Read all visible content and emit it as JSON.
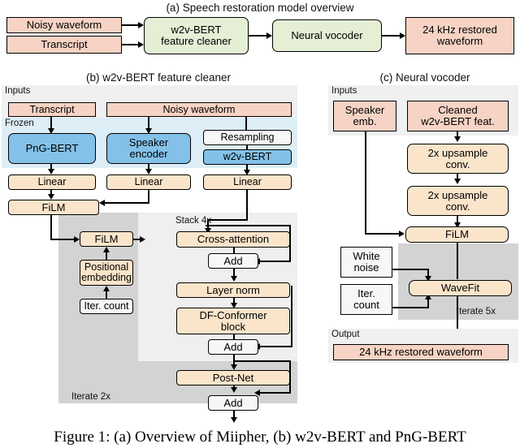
{
  "figure": {
    "caption": "Figure 1: (a) Overview of Miipher, (b) w2v-BERT and PnG-BERT"
  },
  "panel_a": {
    "title": "(a) Speech restoration model overview",
    "nodes": {
      "noisy_waveform": "Noisy waveform",
      "transcript": "Transcript",
      "feature_cleaner_l1": "w2v-BERT",
      "feature_cleaner_l2": "feature cleaner",
      "neural_vocoder": "Neural vocoder",
      "restored_l1": "24 kHz restored",
      "restored_l2": "waveform"
    }
  },
  "panel_b": {
    "title": "(b) w2v-BERT feature cleaner",
    "regions": {
      "inputs": "Inputs",
      "frozen": "Frozen",
      "iterate": "Iterate 2x",
      "stack": "Stack 4x"
    },
    "nodes": {
      "transcript": "Transcript",
      "noisy_waveform": "Noisy waveform",
      "png_bert": "PnG-BERT",
      "speaker_encoder_l1": "Speaker",
      "speaker_encoder_l2": "encoder",
      "resampling": "Resampling",
      "w2v_bert": "w2v-BERT",
      "linear1": "Linear",
      "linear2": "Linear",
      "linear3": "Linear",
      "film_top": "FiLM",
      "film_loop": "FiLM",
      "positional_l1": "Positional",
      "positional_l2": "embedding",
      "iter_count": "Iter. count",
      "cross_attention": "Cross-attention",
      "add1": "Add",
      "layer_norm": "Layer norm",
      "df_conformer_l1": "DF-Conformer",
      "df_conformer_l2": "block",
      "add2": "Add",
      "post_net": "Post-Net",
      "add3": "Add"
    }
  },
  "panel_c": {
    "title": "(c) Neural vocoder",
    "regions": {
      "inputs": "Inputs",
      "iterate": "Iterate 5x",
      "output": "Output"
    },
    "nodes": {
      "speaker_emb_l1": "Speaker",
      "speaker_emb_l2": "emb.",
      "cleaned_l1": "Cleaned",
      "cleaned_l2": "w2v-BERT feat.",
      "upsample1_l1": "2x upsample",
      "upsample1_l2": "conv.",
      "upsample2_l1": "2x upsample",
      "upsample2_l2": "conv.",
      "film": "FiLM",
      "white_noise_l1": "White",
      "white_noise_l2": "noise",
      "iter_count_l1": "Iter.",
      "iter_count_l2": "count",
      "wavefit": "WaveFit",
      "restored": "24 kHz  restored waveform"
    }
  },
  "colors": {
    "pink": "#f6d3c4",
    "green": "#e4efd6",
    "blue": "#83c1e8",
    "cream": "#fae5cb",
    "white_box": "#f7f7f7",
    "region_light": "#f0f0f0",
    "region_gray": "#d3d3d3",
    "region_blue": "#ddeef7"
  }
}
